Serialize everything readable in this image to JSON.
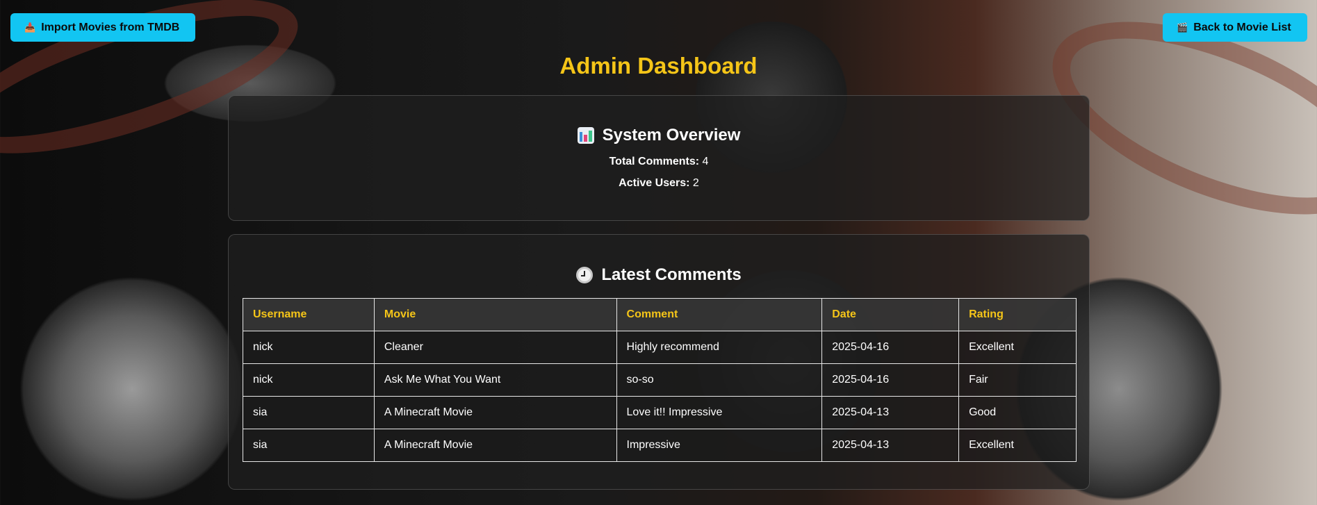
{
  "toolbar": {
    "import_label": "Import Movies from TMDB",
    "import_icon": "inbox-tray-icon",
    "back_label": "Back to Movie List",
    "back_icon": "clapper-board-icon"
  },
  "page": {
    "title": "Admin Dashboard"
  },
  "overview": {
    "heading": "System Overview",
    "heading_icon": "bar-chart-icon",
    "total_comments_label": "Total Comments:",
    "total_comments_value": "4",
    "active_users_label": "Active Users:",
    "active_users_value": "2"
  },
  "comments": {
    "heading": "Latest Comments",
    "heading_icon": "clock-icon",
    "columns": [
      "Username",
      "Movie",
      "Comment",
      "Date",
      "Rating"
    ],
    "rows": [
      [
        "nick",
        "Cleaner",
        "Highly recommend",
        "2025-04-16",
        "Excellent"
      ],
      [
        "nick",
        "Ask Me What You Want",
        "so-so",
        "2025-04-16",
        "Fair"
      ],
      [
        "sia",
        "A Minecraft Movie",
        "Love it!! Impressive",
        "2025-04-13",
        "Good"
      ],
      [
        "sia",
        "A Minecraft Movie",
        "Impressive",
        "2025-04-13",
        "Excellent"
      ]
    ]
  },
  "colors": {
    "accent": "#f5c518",
    "button": "#12c5f2"
  }
}
